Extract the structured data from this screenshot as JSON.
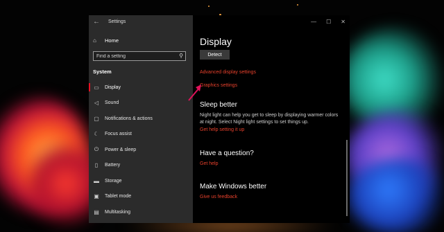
{
  "window": {
    "title": "Settings",
    "controls": [
      "—",
      "☐",
      "✕"
    ]
  },
  "sidebar": {
    "home_label": "Home",
    "search_placeholder": "Find a setting",
    "section_title": "System",
    "items": [
      {
        "label": "Display",
        "icon": "monitor-icon",
        "active": true
      },
      {
        "label": "Sound",
        "icon": "speaker-icon"
      },
      {
        "label": "Notifications & actions",
        "icon": "notifications-icon"
      },
      {
        "label": "Focus assist",
        "icon": "moon-icon"
      },
      {
        "label": "Power & sleep",
        "icon": "power-icon"
      },
      {
        "label": "Battery",
        "icon": "battery-icon"
      },
      {
        "label": "Storage",
        "icon": "storage-icon"
      },
      {
        "label": "Tablet mode",
        "icon": "tablet-icon"
      },
      {
        "label": "Multitasking",
        "icon": "multitasking-icon"
      }
    ]
  },
  "main": {
    "title": "Display",
    "detect_button": "Detect",
    "advanced_display_link": "Advanced display settings",
    "graphics_settings_link": "Graphics settings",
    "sleep_better": {
      "heading": "Sleep better",
      "text": "Night light can help you get to sleep by displaying warmer colors at night. Select Night light settings to set things up.",
      "link": "Get help setting it up"
    },
    "question": {
      "heading": "Have a question?",
      "link": "Get help"
    },
    "better": {
      "heading": "Make Windows better",
      "link": "Give us feedback"
    }
  },
  "colors": {
    "accent": "#e81123",
    "link": "#e8412c",
    "sidebar_bg": "#2b2b2b",
    "content_bg": "#000000",
    "annotation_arrow": "#e0125a"
  }
}
